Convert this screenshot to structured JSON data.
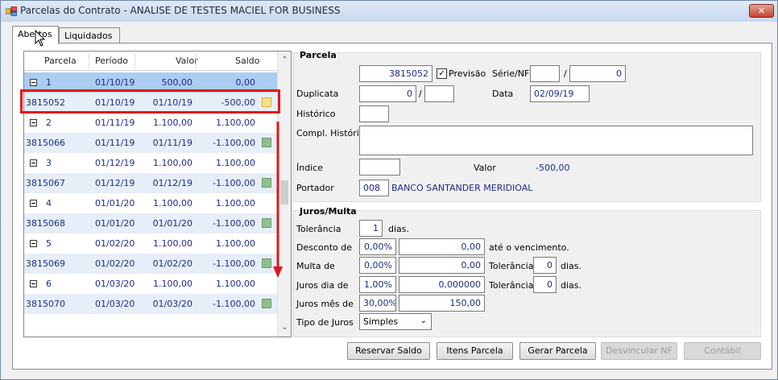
{
  "window": {
    "title": "Parcelas do Contrato - ANALISE DE TESTES MACIEL FOR BUSINESS",
    "close_glyph": "✕"
  },
  "tabs": [
    {
      "label": "Abertos"
    },
    {
      "label": "Liquidados"
    }
  ],
  "grid": {
    "columns": [
      "Parcela",
      "Período",
      "Valor",
      "Saldo"
    ],
    "rows": [
      {
        "parcela": "1",
        "periodo": "01/10/19",
        "valor": "500,00",
        "saldo": "0,00"
      },
      {
        "parcela": "3815052",
        "periodo": "01/10/19",
        "valor": "01/10/19",
        "saldo": "-500,00",
        "swatch": "#f7e08a"
      },
      {
        "parcela": "2",
        "periodo": "01/11/19",
        "valor": "1.100,00",
        "saldo": "1.100,00"
      },
      {
        "parcela": "3815066",
        "periodo": "01/11/19",
        "valor": "01/11/19",
        "saldo": "-1.100,00",
        "swatch": "#8fbf8f"
      },
      {
        "parcela": "3",
        "periodo": "01/12/19",
        "valor": "1.100,00",
        "saldo": "1.100,00"
      },
      {
        "parcela": "3815067",
        "periodo": "01/12/19",
        "valor": "01/12/19",
        "saldo": "-1.100,00",
        "swatch": "#8fbf8f"
      },
      {
        "parcela": "4",
        "periodo": "01/01/20",
        "valor": "1.100,00",
        "saldo": "1.100,00"
      },
      {
        "parcela": "3815068",
        "periodo": "01/01/20",
        "valor": "01/01/20",
        "saldo": "-1.100,00",
        "swatch": "#8fbf8f"
      },
      {
        "parcela": "5",
        "periodo": "01/02/20",
        "valor": "1.100,00",
        "saldo": "1.100,00"
      },
      {
        "parcela": "3815069",
        "periodo": "01/02/20",
        "valor": "01/02/20",
        "saldo": "-1.100,00",
        "swatch": "#8fbf8f"
      },
      {
        "parcela": "6",
        "periodo": "01/03/20",
        "valor": "1.100,00",
        "saldo": "1.100,00"
      },
      {
        "parcela": "3815070",
        "periodo": "01/03/20",
        "valor": "01/03/20",
        "saldo": "-1.100,00",
        "swatch": "#8fbf8f"
      }
    ]
  },
  "parcela": {
    "title": "Parcela",
    "numero": "3815052",
    "previsao_label": "Previsão",
    "previsao_check": "✓",
    "serie_label": "Série/NF",
    "serie_value": "",
    "nf_sep": "/",
    "nf_value": "0",
    "duplicata_label": "Duplicata",
    "duplicata_value": "0",
    "duplicata_sep": "/",
    "duplicata_suffix": "",
    "data_label": "Data",
    "data_value": "02/09/19",
    "historico_label": "Histórico",
    "historico_value": "",
    "compl_label": "Compl. Histórico",
    "compl_value": "",
    "indice_label": "Índice",
    "indice_value": "",
    "valor_label": "Valor",
    "valor_value": "-500,00",
    "portador_label": "Portador",
    "portador_code": "008",
    "portador_name": "BANCO SANTANDER MERIDIOAL"
  },
  "juros": {
    "title": "Juros/Multa",
    "tolerancia_label": "Tolerância",
    "tolerancia_value": "1",
    "dias_label": "dias.",
    "desconto_label": "Desconto de",
    "desconto_pct": "0,00%",
    "desconto_val": "0,00",
    "ate_label": "até o vencimento.",
    "multa_label": "Multa de",
    "multa_pct": "0,00%",
    "multa_val": "0,00",
    "multa_tol_label": "Tolerância",
    "multa_tol_value": "0",
    "multa_dias": "dias.",
    "jdia_label": "Juros dia de",
    "jdia_pct": "1,00%",
    "jdia_val": "0,000000",
    "jdia_tol_label": "Tolerância",
    "jdia_tol_value": "0",
    "jdia_dias": "dias.",
    "jmes_label": "Juros mês de",
    "jmes_pct": "30,00%",
    "jmes_val": "150,00",
    "tipo_label": "Tipo de Juros",
    "tipo_value": "Simples"
  },
  "buttons": {
    "reservar": "Reservar Saldo",
    "itens": "Itens Parcela",
    "gerar": "Gerar Parcela",
    "desvincular": "Desvincular NF",
    "contabil": "Contábil"
  },
  "colors": {
    "highlight": "#e0161b",
    "selected_row": "#abcdf2",
    "link_blue": "#1f2a8a"
  }
}
